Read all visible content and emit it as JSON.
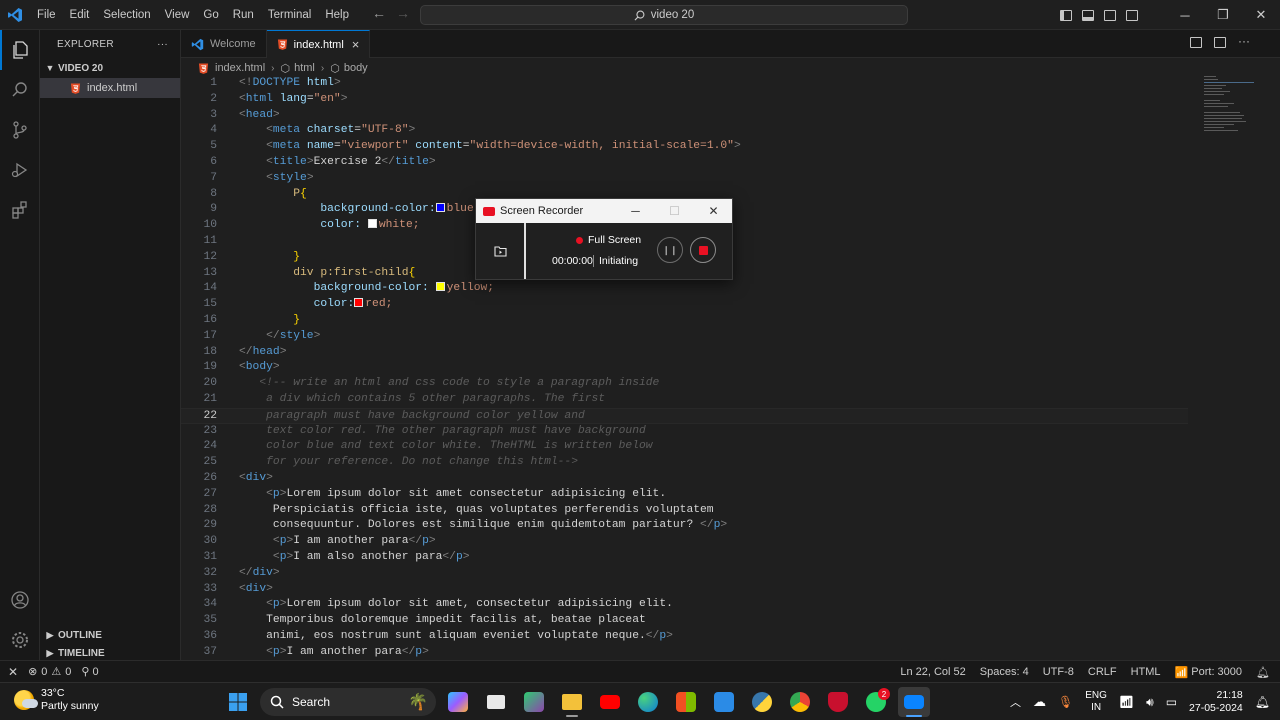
{
  "titlebar": {
    "menu": [
      "File",
      "Edit",
      "Selection",
      "View",
      "Go",
      "Run",
      "Terminal",
      "Help"
    ],
    "search_text": "video 20"
  },
  "sidebar": {
    "header": "EXPLORER",
    "more": "···",
    "folder": "VIDEO 20",
    "file": "index.html",
    "outline": "OUTLINE",
    "timeline": "TIMELINE"
  },
  "tabs": [
    {
      "label": "Welcome"
    },
    {
      "label": "index.html",
      "close": "×"
    }
  ],
  "breadcrumb": [
    "index.html",
    "html",
    "body"
  ],
  "editor": {
    "current_line": 22,
    "lines": [
      "1",
      "2",
      "3",
      "4",
      "5",
      "6",
      "7",
      "8",
      "9",
      "10",
      "11",
      "12",
      "13",
      "14",
      "15",
      "16",
      "17",
      "18",
      "19",
      "20",
      "21",
      "22",
      "23",
      "24",
      "25",
      "26",
      "27",
      "28",
      "29",
      "30",
      "31",
      "32",
      "33",
      "34",
      "35",
      "36",
      "37"
    ]
  },
  "code": {
    "l1": "<!DOCTYPE html>",
    "l3": "<head>",
    "l7": "<style>",
    "l8_sel": "P",
    "l9_prop": "background-color:",
    "l9_val": "blue;",
    "l10_prop": "color: ",
    "l10_val": "white;",
    "l13_sel": "div p:first-child",
    "l14_prop": "background-color: ",
    "l14_val": "yellow;",
    "l15_prop": "color:",
    "l15_val": "red;",
    "l17": "</style>",
    "l18": "</head>",
    "l19": "<body>",
    "l20": "<!-- write an html and css code to style a paragraph inside",
    "l21": "a div which contains 5 other paragraphs. The first",
    "l22": "paragraph must have background color yellow and",
    "l23": "text color red. The other paragraph must have background",
    "l24": "color blue and text color white. TheHTML is written below",
    "l25": "for your reference. Do not change this html-->",
    "l26": "<div>",
    "l27_text": "Lorem ipsum dolor sit amet consectetur adipisicing elit.",
    "l28": " Perspiciatis officia iste, quas voluptates perferendis voluptatem",
    "l29_text": " consequuntur. Dolores est similique enim quidemtotam pariatur? ",
    "l30_text": "I am another para",
    "l31_text": "I am also another para",
    "l32": "</div>",
    "l33": "<div>",
    "l34_text": "Lorem ipsum dolor sit amet, consectetur adipisicing elit.",
    "l35": "Temporibus doloremque impedit facilis at, beatae placeat",
    "l36_text": "animi, eos nostrum sunt aliquam eveniet voluptate neque.",
    "l37_text": "I am another para"
  },
  "recorder": {
    "title": "Screen Recorder",
    "mode": "Full Screen",
    "time": "00:00:00",
    "status": "Initiating"
  },
  "statusbar": {
    "errors": "0",
    "warnings": "0",
    "ports": "0",
    "position": "Ln 22, Col 52",
    "spaces": "Spaces: 4",
    "encoding": "UTF-8",
    "eol": "CRLF",
    "language": "HTML",
    "port": "Port: 3000"
  },
  "taskbar": {
    "temp": "33°C",
    "weather": "Partly sunny",
    "search": "Search",
    "lang1": "ENG",
    "lang2": "IN",
    "time": "21:18",
    "date": "27-05-2024",
    "whatsapp_badge": "2"
  }
}
